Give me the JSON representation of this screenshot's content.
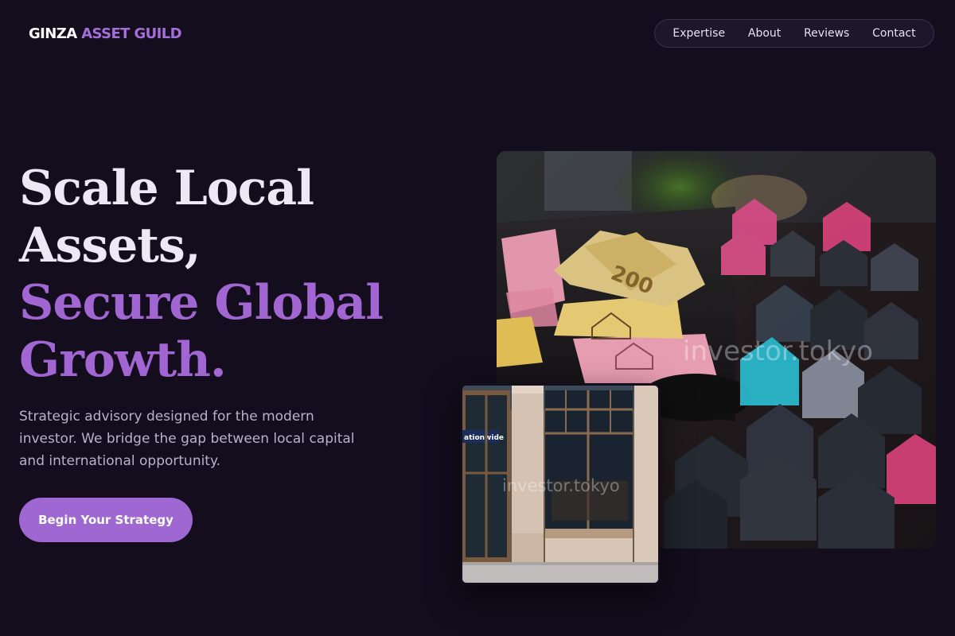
{
  "brand": {
    "part1": "GINZA",
    "part2": "ASSET GUILD"
  },
  "nav": {
    "items": [
      {
        "label": "Expertise"
      },
      {
        "label": "About"
      },
      {
        "label": "Reviews"
      },
      {
        "label": "Contact"
      }
    ]
  },
  "hero": {
    "line1": "Scale Local",
    "line2": "Assets,",
    "line3": "Secure Global",
    "line4": "Growth.",
    "subtext": "Strategic advisory designed for the modern investor. We bridge the gap between local capital and international opportunity.",
    "cta_label": "Begin Your Strategy"
  },
  "images": {
    "main_watermark": "investor.tokyo",
    "main_banknote_text": "200",
    "small_watermark": "investor.tokyo",
    "small_sign_text": "ationwide"
  },
  "colors": {
    "background": "#130d1e",
    "accent": "#9e67d2",
    "brand_accent": "#a46fd8",
    "text_muted": "#b9b3c6"
  }
}
